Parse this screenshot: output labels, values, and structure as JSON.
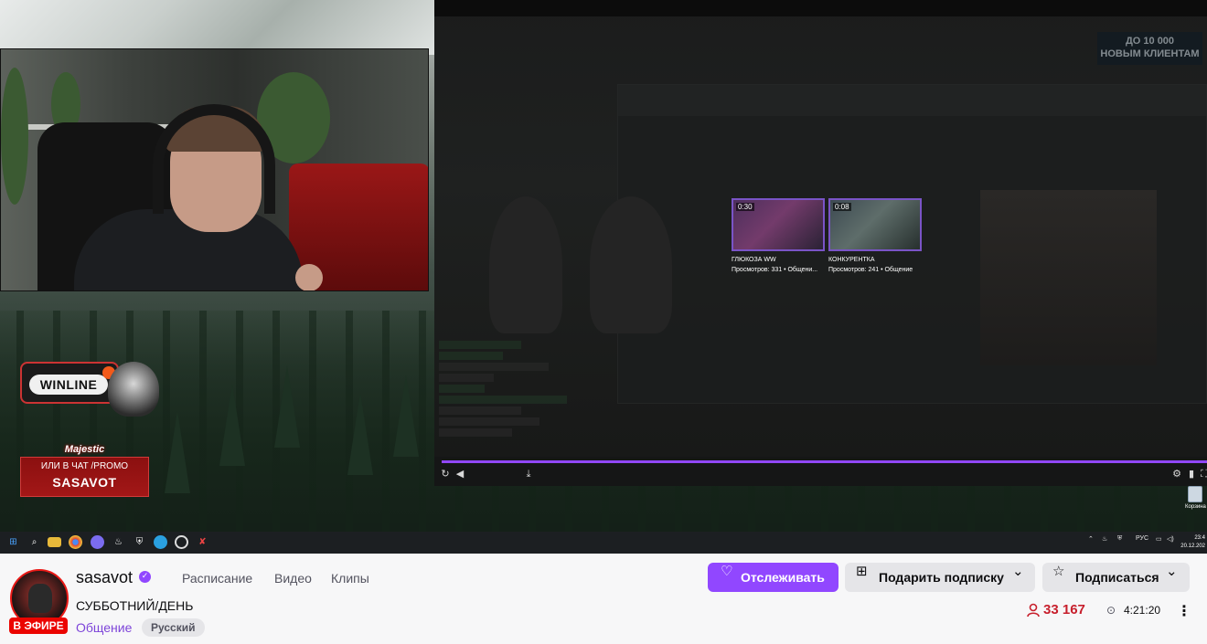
{
  "stream_overlay": {
    "winline_label": "WINLINE",
    "majestic_logo": "Majestic",
    "majestic_line1": "ИЛИ В ЧАТ /PROMO",
    "majestic_line2": "SASAVOT",
    "promo_banner": "ДО 10 000\nНОВЫМ КЛИЕНТАМ",
    "recycle_bin_label": "Корзина"
  },
  "embedded_player": {
    "thumbnails": [
      {
        "duration": "0:30",
        "title": "ГЛЮКОЗА WW",
        "meta": "Просмотров: 331 • Общени..."
      },
      {
        "duration": "0:08",
        "title": "КОНКУРЕНТКА",
        "meta": "Просмотров: 241 • Общение"
      }
    ]
  },
  "taskbar": {
    "lang": "РУС",
    "time": "23:4",
    "date": "20.12.202"
  },
  "channel": {
    "name": "sasavot",
    "live_label": "В ЭФИРЕ",
    "nav": [
      "Расписание",
      "Видео",
      "Клипы"
    ],
    "stream_title": "СУББОТНИЙ/ДЕНЬ",
    "category": "Общение",
    "tag": "Русский",
    "follow_label": "Отслеживать",
    "gift_label": "Подарить подписку",
    "subscribe_label": "Подписаться",
    "viewer_count": "33 167",
    "uptime": "4:21:20"
  },
  "colors": {
    "accent": "#9147ff",
    "live": "#eb0400",
    "viewers": "#c71f2c"
  }
}
